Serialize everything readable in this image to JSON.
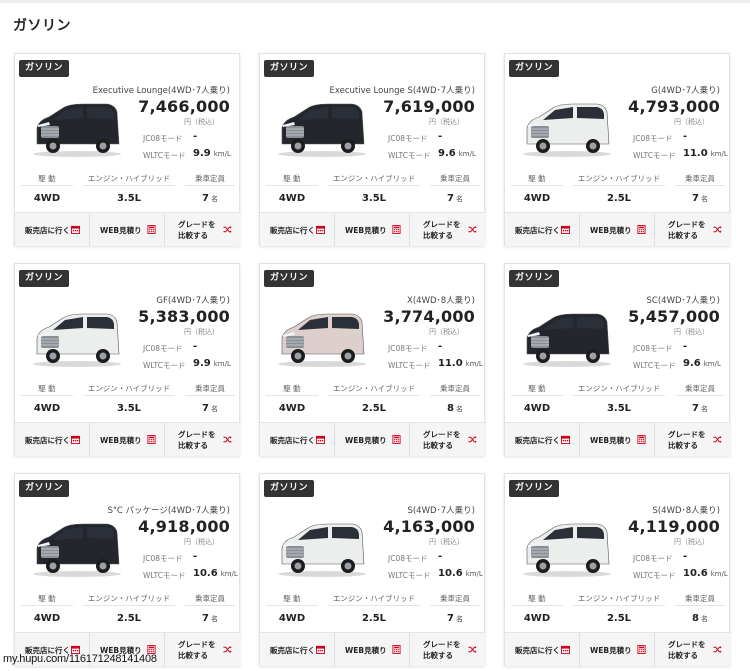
{
  "section": {
    "title": "ガソリン"
  },
  "labels": {
    "badge": "ガソリン",
    "tax": "円（税込）",
    "jc08": "JC08モード",
    "wltc": "WLTCモード",
    "fuel_unit": "km/L",
    "drive_header": "駆 動",
    "engine_header": "エンジン・ハイブリッド",
    "capacity_header": "乗車定員",
    "capacity_unit": "名",
    "dealer_button": "販売店に行く",
    "web_estimate_button": "WEB見積り",
    "compare_button": "グレードを比較する"
  },
  "colors": {
    "badge_bg": "#333333",
    "accent": "#d0021b",
    "action_bg": "#f5f5f5"
  },
  "cars": [
    {
      "grade": "Executive Lounge(4WD･7人乗り)",
      "price": "7,466,000",
      "jc08": "-",
      "wltc": "9.9",
      "drive": "4WD",
      "engine": "3.5L",
      "capacity": "7",
      "body_color": "dark"
    },
    {
      "grade": "Executive Lounge S(4WD･7人乗り)",
      "price": "7,619,000",
      "jc08": "-",
      "wltc": "9.6",
      "drive": "4WD",
      "engine": "3.5L",
      "capacity": "7",
      "body_color": "dark"
    },
    {
      "grade": "G(4WD･7人乗り)",
      "price": "4,793,000",
      "jc08": "-",
      "wltc": "11.0",
      "drive": "4WD",
      "engine": "2.5L",
      "capacity": "7",
      "body_color": "white"
    },
    {
      "grade": "GF(4WD･7人乗り)",
      "price": "5,383,000",
      "jc08": "-",
      "wltc": "9.9",
      "drive": "4WD",
      "engine": "3.5L",
      "capacity": "7",
      "body_color": "white"
    },
    {
      "grade": "X(4WD･8人乗り)",
      "price": "3,774,000",
      "jc08": "-",
      "wltc": "11.0",
      "drive": "4WD",
      "engine": "2.5L",
      "capacity": "8",
      "body_color": "pink"
    },
    {
      "grade": "SC(4WD･7人乗り)",
      "price": "5,457,000",
      "jc08": "-",
      "wltc": "9.6",
      "drive": "4WD",
      "engine": "3.5L",
      "capacity": "7",
      "body_color": "dark"
    },
    {
      "grade": "S\"C パッケージ(4WD･7人乗り)",
      "price": "4,918,000",
      "jc08": "-",
      "wltc": "10.6",
      "drive": "4WD",
      "engine": "2.5L",
      "capacity": "7",
      "body_color": "dark"
    },
    {
      "grade": "S(4WD･7人乗り)",
      "price": "4,163,000",
      "jc08": "-",
      "wltc": "10.6",
      "drive": "4WD",
      "engine": "2.5L",
      "capacity": "7",
      "body_color": "white"
    },
    {
      "grade": "S(4WD･8人乗り)",
      "price": "4,119,000",
      "jc08": "-",
      "wltc": "10.6",
      "drive": "4WD",
      "engine": "2.5L",
      "capacity": "8",
      "body_color": "white"
    }
  ],
  "watermark": "my.hupu.com/116171248141408"
}
